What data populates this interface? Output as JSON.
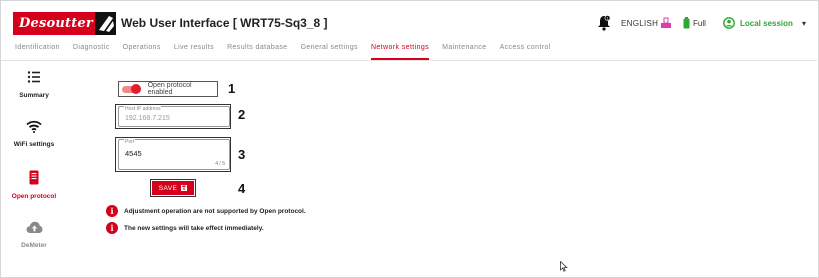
{
  "header": {
    "logo_text": "Desoutter",
    "title": "Web User Interface [ WRT75-Sq3_8 ]",
    "language": "ENGLISH",
    "battery_label": "Full",
    "session": "Local session",
    "colors": {
      "brand": "#d5001c",
      "session": "#2ea836",
      "usb": "#d93fa8"
    }
  },
  "tabs": [
    {
      "label": "Identification"
    },
    {
      "label": "Diagnostic"
    },
    {
      "label": "Operations"
    },
    {
      "label": "Live results"
    },
    {
      "label": "Results database"
    },
    {
      "label": "General settings"
    },
    {
      "label": "Network settings",
      "active": true
    },
    {
      "label": "Maintenance"
    },
    {
      "label": "Access control"
    }
  ],
  "sidebar": {
    "items": [
      {
        "label": "Summary",
        "icon": "list-icon"
      },
      {
        "label": "WiFi settings",
        "icon": "wifi-icon"
      },
      {
        "label": "Open protocol",
        "icon": "device-icon",
        "active": true
      },
      {
        "label": "DeMeter",
        "icon": "cloud-upload-icon",
        "disabled": true
      }
    ]
  },
  "form": {
    "toggle_label": "Open protocol enabled",
    "toggle_on": true,
    "ip_legend": "Host IP address",
    "ip_value": "192.168.7.215",
    "port_legend": "Port",
    "port_value": "4545",
    "port_counter": "4 / 5",
    "save_label": "SAVE"
  },
  "callouts": [
    "1",
    "2",
    "3",
    "4"
  ],
  "messages": [
    "Adjustment operation are not supported by Open protocol.",
    "The new settings will take effect immediately."
  ]
}
